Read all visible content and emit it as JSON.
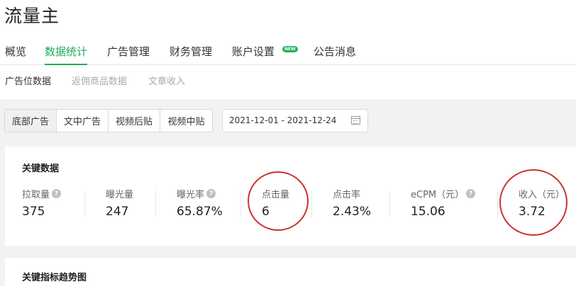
{
  "header": {
    "title": "流量主"
  },
  "nav": {
    "items": [
      {
        "label": "概览"
      },
      {
        "label": "数据统计"
      },
      {
        "label": "广告管理"
      },
      {
        "label": "财务管理"
      },
      {
        "label": "账户设置"
      },
      {
        "label": "公告消息"
      }
    ],
    "active": "数据统计",
    "new_badge": "NEW"
  },
  "subnav": {
    "items": [
      {
        "label": "广告位数据"
      },
      {
        "label": "返佣商品数据"
      },
      {
        "label": "文章收入"
      }
    ],
    "active": "广告位数据"
  },
  "filters": {
    "ad_types": [
      {
        "label": "底部广告"
      },
      {
        "label": "文中广告"
      },
      {
        "label": "视频后贴"
      },
      {
        "label": "视频中贴"
      }
    ],
    "active": "底部广告",
    "date_range": "2021-12-01 - 2021-12-24"
  },
  "key_data": {
    "title": "关键数据",
    "metrics": [
      {
        "label": "拉取量",
        "value": "375",
        "help": "?"
      },
      {
        "label": "曝光量",
        "value": "247"
      },
      {
        "label": "曝光率",
        "value": "65.87%",
        "help": "?"
      },
      {
        "label": "点击量",
        "value": "6"
      },
      {
        "label": "点击率",
        "value": "2.43%"
      },
      {
        "label": "eCPM（元）",
        "value": "15.06",
        "help": "?"
      },
      {
        "label": "收入（元）",
        "value": "3.72"
      }
    ]
  },
  "trend": {
    "title": "关键指标趋势图"
  },
  "colors": {
    "accent": "#1aad5a",
    "annotation": "#cc3333",
    "badge": "#22b35e"
  }
}
